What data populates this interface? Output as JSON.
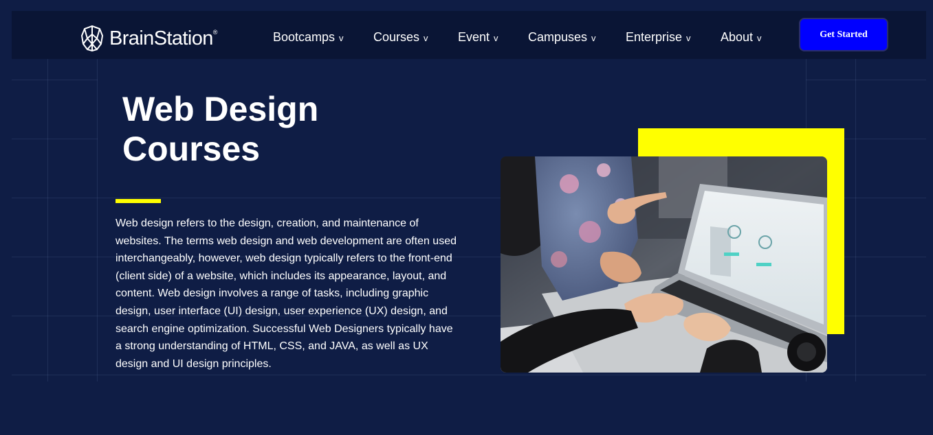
{
  "brand": {
    "name": "BrainStation",
    "registered_mark": "®"
  },
  "nav": {
    "items": [
      {
        "label": "Bootcamps",
        "chevron": "v"
      },
      {
        "label": "Courses",
        "chevron": "v"
      },
      {
        "label": "Event",
        "chevron": "v"
      },
      {
        "label": "Campuses",
        "chevron": "v"
      },
      {
        "label": "Enterprise",
        "chevron": "v"
      },
      {
        "label": "About",
        "chevron": "v"
      }
    ],
    "cta_label": "Get Started"
  },
  "hero": {
    "title_line1": "Web Design",
    "title_line2": "Courses",
    "body": "Web design refers to the design, creation, and maintenance of websites. The terms web design and web development are often used interchangeably, however, web design typically refers to the front-end (client side) of a website, which includes its appearance, layout, and content. Web design involves a range of tasks, including graphic design, user interface (UI) design, user experience (UX) design, and search engine optimization. Successful Web Designers typically have a strong understanding of HTML, CSS, and JAVA, as well as UX design and UI design principles.",
    "image_icon": "people-laptop-photo"
  },
  "colors": {
    "background": "#0f1d45",
    "navbar": "#0a1535",
    "accent_yellow": "#ffff00",
    "cta_blue": "#0000ff",
    "text": "#ffffff"
  }
}
